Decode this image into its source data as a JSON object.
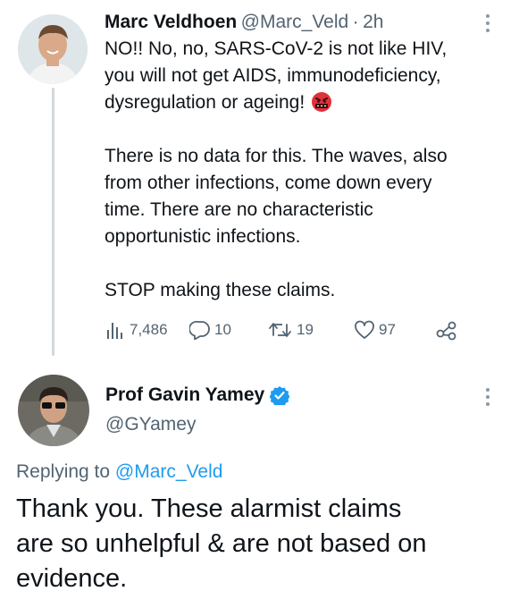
{
  "tweet1": {
    "author_name": "Marc Veldhoen",
    "author_handle": "@Marc_Veld",
    "separator": "·",
    "time": "2h",
    "text": "NO!! No, no, SARS-CoV-2 is not like HIV,\nyou will not get AIDS, immunodeficiency,\ndysregulation or ageing!",
    "emoji": "angry-face-with-symbols",
    "text2": "There is no data for this. The waves, also\nfrom other infections, come down every\ntime. There are no characteristic\nopportunistic infections.\n\nSTOP making these claims.",
    "metrics": {
      "views": "7,486",
      "replies": "10",
      "retweets": "19",
      "likes": "97"
    }
  },
  "tweet2": {
    "author_name": "Prof Gavin Yamey",
    "author_handle": "@GYamey",
    "verified": true,
    "replying_prefix": "Replying to",
    "replying_handle": "@Marc_Veld",
    "text": "Thank you. These alarmist claims\nare so unhelpful & are not based on\nevidence."
  },
  "colors": {
    "text": "#0f1419",
    "secondary": "#536471",
    "link": "#1d9bf0",
    "thread_line": "#cfd9de",
    "emoji_red": "#e0303a"
  }
}
